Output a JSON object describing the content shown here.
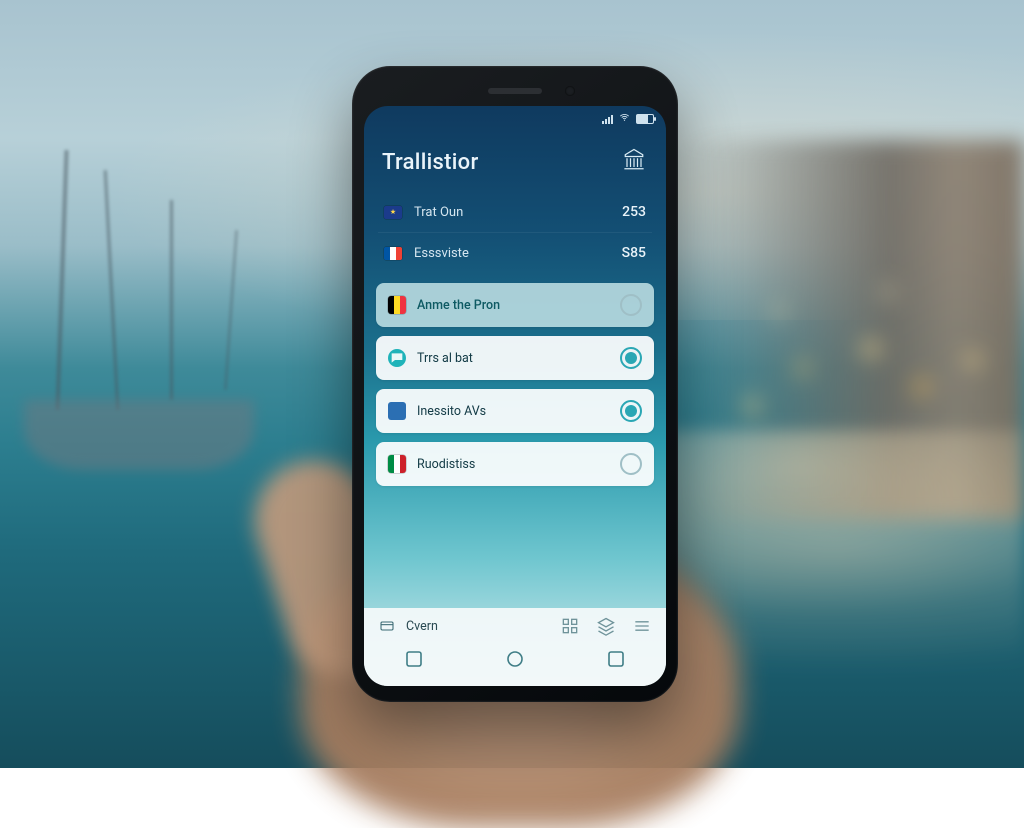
{
  "statusbar": {
    "time": "",
    "carrier": ""
  },
  "header": {
    "title": "Trallistior"
  },
  "top_rows": [
    {
      "flag": "eu",
      "label": "Trat Oun",
      "value": "253"
    },
    {
      "flag": "fr",
      "label": "Esssviste",
      "value": "S85"
    }
  ],
  "cards": [
    {
      "icon": "flag-be",
      "label": "Anme the Pron",
      "control": "radio-dim",
      "tinted": true
    },
    {
      "icon": "chat",
      "label": "Trrs al bat",
      "control": "radio-on"
    },
    {
      "icon": "sq-blue",
      "label": "Inessito AVs",
      "control": "radio-on"
    },
    {
      "icon": "flag-it",
      "label": "Ruodistiss",
      "control": "radio-dim"
    }
  ],
  "bottom": {
    "label": "Cvern"
  }
}
